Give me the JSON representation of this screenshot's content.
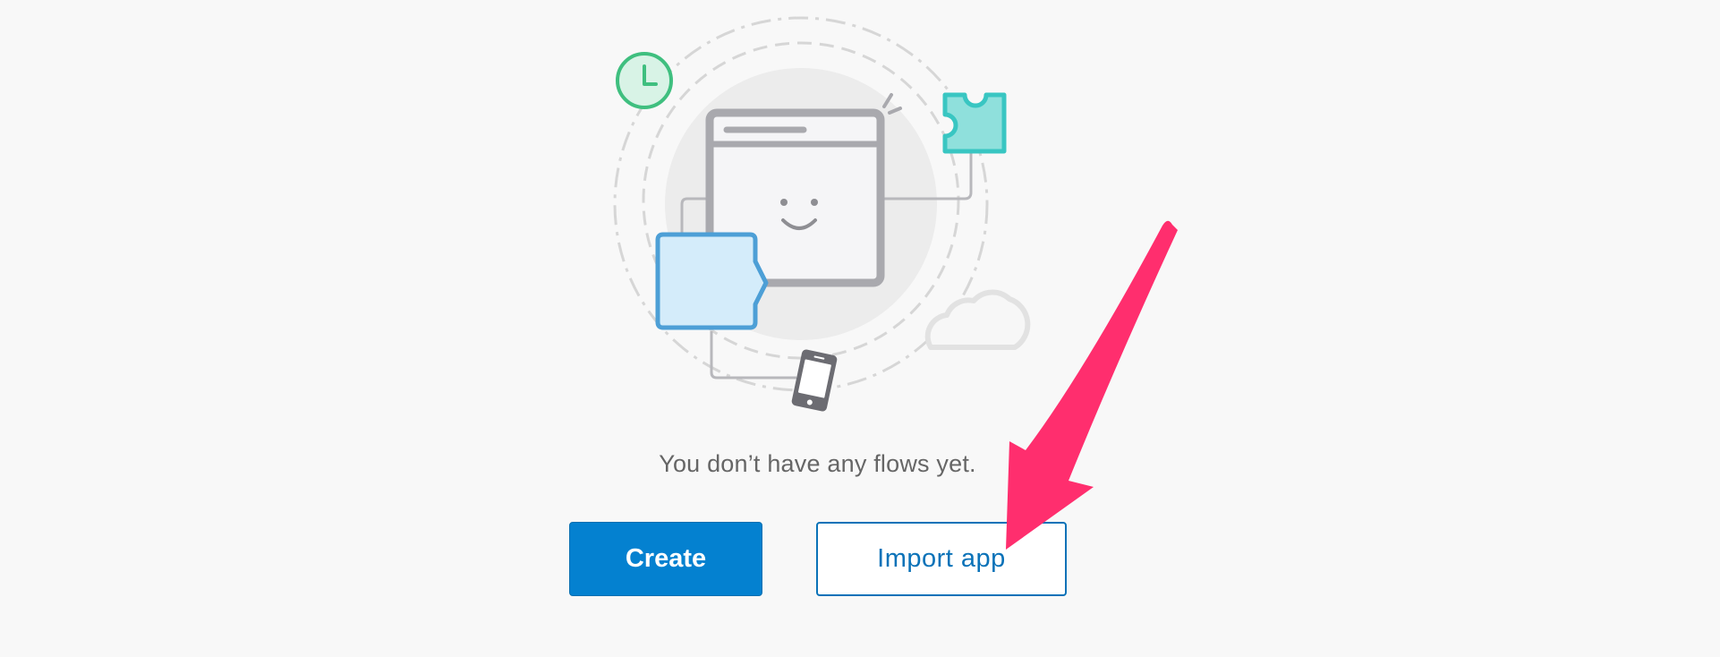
{
  "empty_state": {
    "message": "You don’t have any flows yet."
  },
  "actions": {
    "create_label": "Create",
    "import_label": "Import app"
  },
  "colors": {
    "primary": "#0481d0",
    "secondary_text": "#0a72b8",
    "annotation_arrow": "#ff2e6e"
  },
  "illustration_icons": [
    "clock-icon",
    "puzzle-piece-icon",
    "browser-window-icon",
    "folder-icon",
    "cloud-icon",
    "phone-icon"
  ]
}
